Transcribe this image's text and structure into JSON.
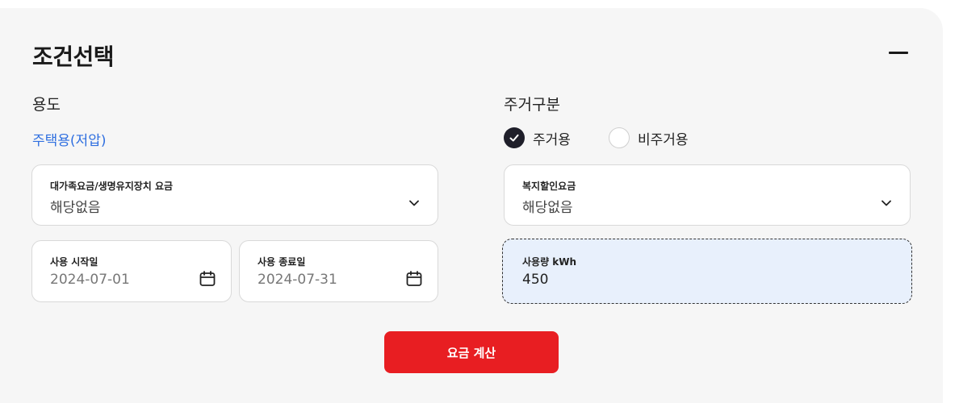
{
  "section": {
    "title": "조건선택"
  },
  "usage_type": {
    "label": "용도",
    "value": "주택용(저압)"
  },
  "residence_type": {
    "label": "주거구분",
    "options": [
      {
        "label": "주거용",
        "selected": true
      },
      {
        "label": "비주거용",
        "selected": false
      }
    ]
  },
  "family_discount": {
    "label": "대가족요금/생명유지장치 요금",
    "value": "해당없음"
  },
  "welfare_discount": {
    "label": "복지할인요금",
    "value": "해당없음"
  },
  "start_date": {
    "label": "사용 시작일",
    "value": "2024-07-01"
  },
  "end_date": {
    "label": "사용 종료일",
    "value": "2024-07-31"
  },
  "usage_amount": {
    "label": "사용량 kWh",
    "value": "450"
  },
  "calculate_button": {
    "label": "요금 계산"
  },
  "colors": {
    "accent_blue": "#2f6fe0",
    "button_red": "#e81e22",
    "input_highlight": "#e8f0fc"
  }
}
